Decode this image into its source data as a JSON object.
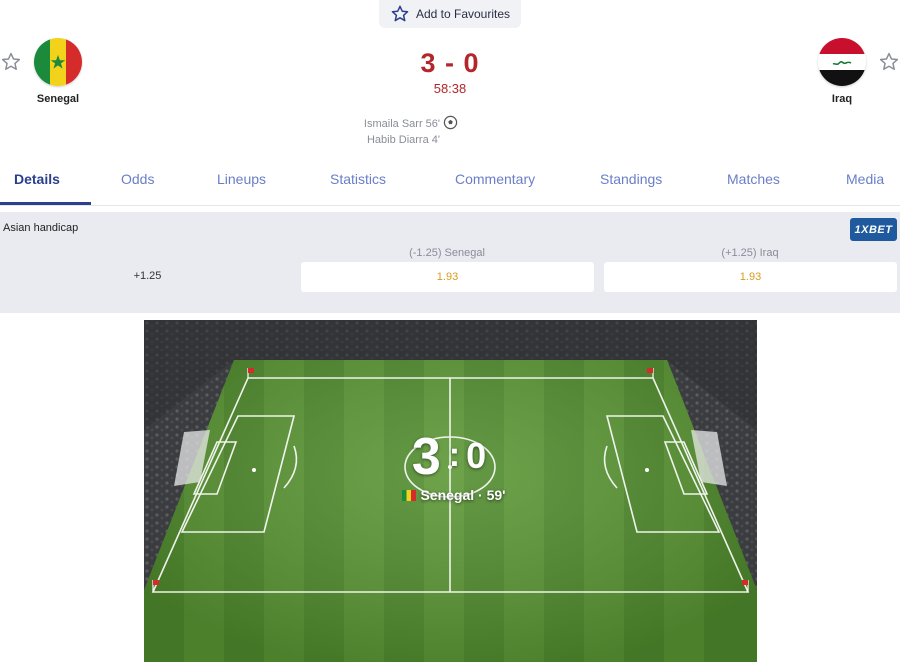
{
  "header": {
    "favourite_label": "Add to Favourites",
    "icons": {
      "favourite": "star-outline-icon",
      "home_star": "star-outline-icon",
      "away_star": "star-outline-icon",
      "goal": "soccer-ball-icon"
    }
  },
  "match": {
    "home": {
      "name": "Senegal",
      "flag": "senegal-flag"
    },
    "away": {
      "name": "Iraq",
      "flag": "iraq-flag"
    },
    "score": "3 - 0",
    "clock": "58:38",
    "scorers": [
      "Ismaila Sarr 56'",
      "Habib Diarra 4'"
    ]
  },
  "tabs": [
    {
      "label": "Details",
      "active": true
    },
    {
      "label": "Odds"
    },
    {
      "label": "Lineups"
    },
    {
      "label": "Statistics"
    },
    {
      "label": "Commentary"
    },
    {
      "label": "Standings"
    },
    {
      "label": "Matches"
    },
    {
      "label": "Media"
    }
  ],
  "odds": {
    "title": "Asian handicap",
    "bookmaker": "1XBET",
    "line": "+1.25",
    "home_label": "(-1.25) Senegal",
    "home_odd": "1.93",
    "away_label": "(+1.25) Iraq",
    "away_odd": "1.93"
  },
  "pitch": {
    "score_home": "3",
    "score_sep": ":",
    "score_away": "0",
    "event_text": "Senegal · 59'"
  },
  "colors": {
    "accent": "#2c3f8f",
    "tab_text": "#6a7ec8",
    "score_red": "#b3262a",
    "odd_orange": "#d99a1f",
    "bookmaker_blue": "#1f5a9e",
    "pitch_green": "#4f8b2c"
  }
}
